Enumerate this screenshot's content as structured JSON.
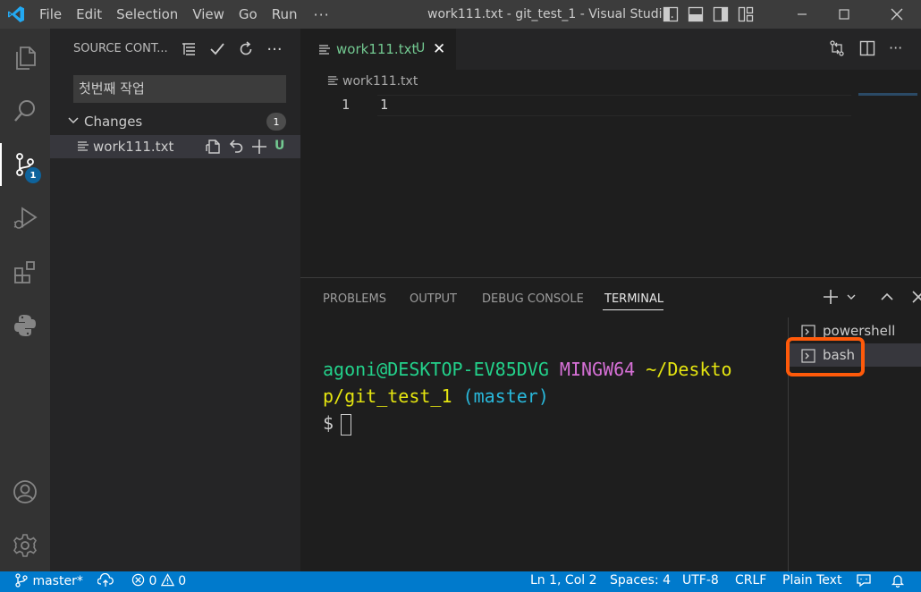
{
  "titlebar": {
    "menus": [
      "File",
      "Edit",
      "Selection",
      "View",
      "Go",
      "Run"
    ],
    "window_title": "work111.txt - git_test_1 - Visual Studi..."
  },
  "activity": {
    "scm_badge": "1"
  },
  "sidebar": {
    "title": "SOURCE CONT...",
    "commit_message": "첫번째 작업",
    "changes_label": "Changes",
    "changes_count": "1",
    "file_name": "work111.txt",
    "file_status": "U"
  },
  "editor": {
    "tab_name": "work111.txt",
    "tab_status": "U",
    "breadcrumb": "work111.txt",
    "line_number": "1",
    "line_content": "1"
  },
  "panel": {
    "tabs": [
      "PROBLEMS",
      "OUTPUT",
      "DEBUG CONSOLE",
      "TERMINAL"
    ],
    "active_tab": "TERMINAL",
    "terminal": {
      "user_host": "agoni@DESKTOP-EV85DVG",
      "env": "MINGW64",
      "path_part1": "~/Deskto",
      "path_part2": "p/git_test_1",
      "branch": "(master)",
      "prompt": "$"
    },
    "terminals": [
      "powershell",
      "bash"
    ]
  },
  "statusbar": {
    "branch": "master*",
    "errors": "0",
    "warnings": "0",
    "position": "Ln 1, Col 2",
    "spaces": "Spaces: 4",
    "encoding": "UTF-8",
    "eol": "CRLF",
    "language": "Plain Text"
  },
  "colors": {
    "accent": "#007acc",
    "untracked": "#73c991",
    "term_green": "#23d18b",
    "term_magenta": "#d670d6",
    "term_yellow": "#e5e510",
    "term_cyan": "#29b8db",
    "highlight": "#ff5a0a"
  }
}
